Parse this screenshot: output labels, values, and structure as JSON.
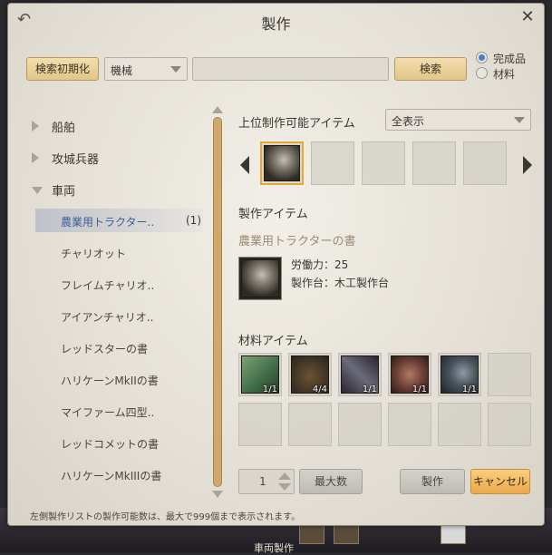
{
  "window": {
    "title": "製作"
  },
  "search": {
    "reset_label": "検索初期化",
    "category_value": "機械",
    "query": "",
    "search_label": "検索",
    "radio_finished": "完成品",
    "radio_material": "材料"
  },
  "tree": {
    "top": [
      {
        "label": "船舶",
        "expanded": false
      },
      {
        "label": "攻城兵器",
        "expanded": false
      },
      {
        "label": "車両",
        "expanded": true
      }
    ],
    "children": [
      {
        "label": "農業用トラクター..",
        "count": "(1)",
        "selected": true
      },
      {
        "label": "チャリオット"
      },
      {
        "label": "フレイムチャリオ.."
      },
      {
        "label": "アイアンチャリオ.."
      },
      {
        "label": "レッドスターの書"
      },
      {
        "label": "ハリケーンMkIIの書"
      },
      {
        "label": "マイファーム四型.."
      },
      {
        "label": "レッドコメットの書"
      },
      {
        "label": "ハリケーンMkIIIの書"
      }
    ]
  },
  "upper": {
    "title": "上位制作可能アイテム",
    "filter_value": "全表示"
  },
  "production": {
    "title": "製作アイテム",
    "item_name": "農業用トラクターの書",
    "labor_label": "労働力：25",
    "bench_label": "製作台：木工製作台"
  },
  "materials": {
    "title": "材料アイテム",
    "items": [
      {
        "icon": "circuit-board-icon",
        "qty": "1/1"
      },
      {
        "icon": "cannon-wheel-icon",
        "qty": "4/4"
      },
      {
        "icon": "needle-icon",
        "qty": "1/1"
      },
      {
        "icon": "spool-icon",
        "qty": "1/1"
      },
      {
        "icon": "gun-part-icon",
        "qty": "1/1"
      }
    ]
  },
  "controls": {
    "quantity": "1",
    "max_label": "最大数",
    "craft_label": "製作",
    "cancel_label": "キャンセル"
  },
  "footer": {
    "note": "左側製作リストの製作可能数は、最大で999個まで表示されます。"
  },
  "taskbar": {
    "label": "車両製作"
  },
  "colors": {
    "accent_orange": "#eba94d",
    "selected_blue": "#4a7ec6",
    "selection_border": "#e8a53a"
  }
}
